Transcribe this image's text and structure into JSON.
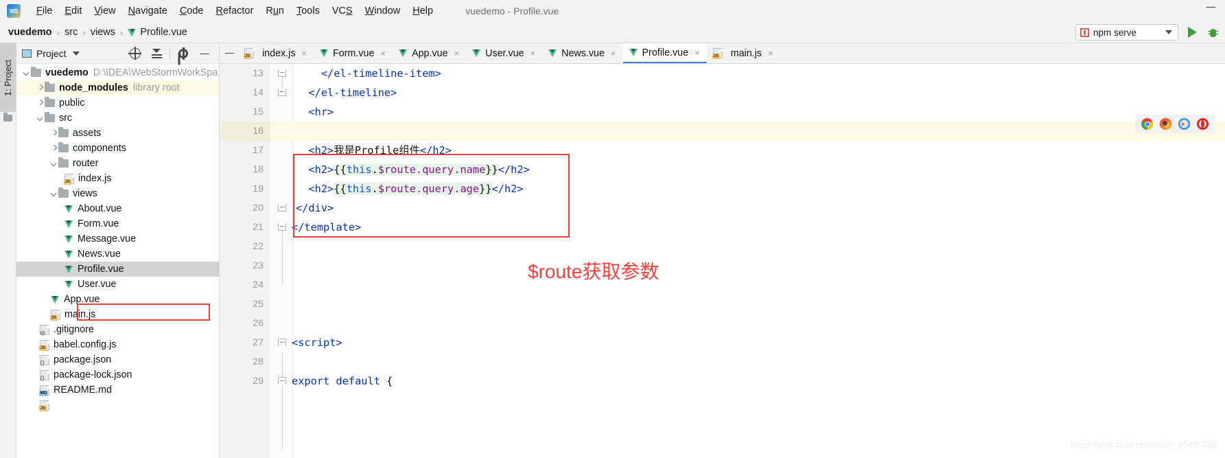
{
  "window": {
    "title": "vuedemo - Profile.vue",
    "app_icon": "webstorm-logo",
    "minimize_label": "—"
  },
  "menubar": {
    "items": [
      {
        "label": "File",
        "mnemonic": "F"
      },
      {
        "label": "Edit",
        "mnemonic": "E"
      },
      {
        "label": "View",
        "mnemonic": "V"
      },
      {
        "label": "Navigate",
        "mnemonic": "N"
      },
      {
        "label": "Code",
        "mnemonic": "C"
      },
      {
        "label": "Refactor",
        "mnemonic": "R"
      },
      {
        "label": "Run",
        "mnemonic": "u"
      },
      {
        "label": "Tools",
        "mnemonic": "T"
      },
      {
        "label": "VCS",
        "mnemonic": "S"
      },
      {
        "label": "Window",
        "mnemonic": "W"
      },
      {
        "label": "Help",
        "mnemonic": "H"
      }
    ]
  },
  "breadcrumb": {
    "separator": "›",
    "items": [
      {
        "label": "vuedemo",
        "bold": true,
        "icon": ""
      },
      {
        "label": "src",
        "bold": false,
        "icon": ""
      },
      {
        "label": "views",
        "bold": false,
        "icon": ""
      },
      {
        "label": "Profile.vue",
        "bold": false,
        "icon": "vue-icon"
      }
    ]
  },
  "run_widget": {
    "config_name": "npm serve",
    "config_icon": "npm-icon",
    "dropdown_icon": "chevron-down-icon",
    "run_icon": "run-play-icon",
    "debug_icon": "debug-bug-icon"
  },
  "toolwindow_strip": {
    "project_button": "1: Project",
    "structure_icon": "folder-icon"
  },
  "project_panel": {
    "title": "Project",
    "title_icon": "project-window-icon",
    "dropdown_icon": "chevron-down-icon",
    "toolbar_icons": [
      "locate-target-icon",
      "collapse-all-icon",
      "gear-icon",
      "hide-minus-icon"
    ],
    "tree": [
      {
        "label": "vuedemo",
        "sub": "D:\\IDEA\\WebStormWorkSpa",
        "icon": "folder-icon",
        "arrow": "down",
        "indent": 1,
        "bold": true,
        "highlight": "none"
      },
      {
        "label": "node_modules",
        "sub": "library root",
        "icon": "folder-icon",
        "arrow": "right",
        "indent": 2,
        "bold": true,
        "highlight": "yellow"
      },
      {
        "label": "public",
        "sub": "",
        "icon": "folder-icon",
        "arrow": "right",
        "indent": 2,
        "bold": false,
        "highlight": "none"
      },
      {
        "label": "src",
        "sub": "",
        "icon": "folder-icon",
        "arrow": "down",
        "indent": 2,
        "bold": false,
        "highlight": "none"
      },
      {
        "label": "assets",
        "sub": "",
        "icon": "folder-icon",
        "arrow": "right",
        "indent": 3,
        "bold": false,
        "highlight": "none"
      },
      {
        "label": "components",
        "sub": "",
        "icon": "folder-icon",
        "arrow": "right",
        "indent": 3,
        "bold": false,
        "highlight": "none"
      },
      {
        "label": "router",
        "sub": "",
        "icon": "folder-icon",
        "arrow": "down",
        "indent": 3,
        "bold": false,
        "highlight": "none"
      },
      {
        "label": "index.js",
        "sub": "",
        "icon": "js-file-icon",
        "arrow": "none",
        "indent": 4,
        "bold": false,
        "highlight": "none"
      },
      {
        "label": "views",
        "sub": "",
        "icon": "folder-icon",
        "arrow": "down",
        "indent": 3,
        "bold": false,
        "highlight": "none"
      },
      {
        "label": "About.vue",
        "sub": "",
        "icon": "vue-file-icon",
        "arrow": "none",
        "indent": 4,
        "bold": false,
        "highlight": "none"
      },
      {
        "label": "Form.vue",
        "sub": "",
        "icon": "vue-file-icon",
        "arrow": "none",
        "indent": 4,
        "bold": false,
        "highlight": "none"
      },
      {
        "label": "Message.vue",
        "sub": "",
        "icon": "vue-file-icon",
        "arrow": "none",
        "indent": 4,
        "bold": false,
        "highlight": "none"
      },
      {
        "label": "News.vue",
        "sub": "",
        "icon": "vue-file-icon",
        "arrow": "none",
        "indent": 4,
        "bold": false,
        "highlight": "none"
      },
      {
        "label": "Profile.vue",
        "sub": "",
        "icon": "vue-file-icon",
        "arrow": "none",
        "indent": 4,
        "bold": false,
        "highlight": "selected"
      },
      {
        "label": "User.vue",
        "sub": "",
        "icon": "vue-file-icon",
        "arrow": "none",
        "indent": 4,
        "bold": false,
        "highlight": "none"
      },
      {
        "label": "App.vue",
        "sub": "",
        "icon": "vue-file-icon",
        "arrow": "none",
        "indent": 3,
        "bold": false,
        "highlight": "none"
      },
      {
        "label": "main.js",
        "sub": "",
        "icon": "js-file-icon",
        "arrow": "none",
        "indent": 3,
        "bold": false,
        "highlight": "none"
      },
      {
        "label": ".gitignore",
        "sub": "",
        "icon": "gitignore-file-icon",
        "arrow": "none",
        "indent": 5,
        "bold": false,
        "highlight": "none"
      },
      {
        "label": "babel.config.js",
        "sub": "",
        "icon": "js-file-icon",
        "arrow": "none",
        "indent": 5,
        "bold": false,
        "highlight": "none"
      },
      {
        "label": "package.json",
        "sub": "",
        "icon": "json-file-icon",
        "arrow": "none",
        "indent": 5,
        "bold": false,
        "highlight": "none"
      },
      {
        "label": "package-lock.json",
        "sub": "",
        "icon": "json-file-icon",
        "arrow": "none",
        "indent": 5,
        "bold": false,
        "highlight": "none"
      },
      {
        "label": "README.md",
        "sub": "",
        "icon": "md-file-icon",
        "arrow": "none",
        "indent": 5,
        "bold": false,
        "highlight": "none"
      }
    ]
  },
  "editor": {
    "tabs": [
      {
        "label": "index.js",
        "icon": "js-file-icon",
        "active": false,
        "closable": true
      },
      {
        "label": "Form.vue",
        "icon": "vue-file-icon",
        "active": false,
        "closable": true
      },
      {
        "label": "App.vue",
        "icon": "vue-file-icon",
        "active": false,
        "closable": true
      },
      {
        "label": "User.vue",
        "icon": "vue-file-icon",
        "active": false,
        "closable": true
      },
      {
        "label": "News.vue",
        "icon": "vue-file-icon",
        "active": false,
        "closable": true
      },
      {
        "label": "Profile.vue",
        "icon": "vue-file-icon",
        "active": true,
        "closable": true
      },
      {
        "label": "main.js",
        "icon": "js-file-icon",
        "active": false,
        "closable": true
      }
    ],
    "close_glyph": "×",
    "hide_glyph": "—",
    "lines": [
      {
        "num": "13",
        "text": "    </el-timeline-item>"
      },
      {
        "num": "14",
        "text": "  </el-timeline>"
      },
      {
        "num": "15",
        "text": "  <hr>"
      },
      {
        "num": "16",
        "text": ""
      },
      {
        "num": "17",
        "text": "  <h2>我是Profile组件</h2>"
      },
      {
        "num": "18",
        "text": "  <h2>{{this.$route.query.name}}</h2>"
      },
      {
        "num": "19",
        "text": "  <h2>{{this.$route.query.age}}</h2>"
      },
      {
        "num": "20",
        "text": "  </div>"
      },
      {
        "num": "21",
        "text": "</template>"
      },
      {
        "num": "22",
        "text": ""
      },
      {
        "num": "23",
        "text": ""
      },
      {
        "num": "24",
        "text": ""
      },
      {
        "num": "25",
        "text": ""
      },
      {
        "num": "26",
        "text": ""
      },
      {
        "num": "27",
        "text": "<script>"
      },
      {
        "num": "28",
        "text": ""
      },
      {
        "num": "29",
        "text": "export default {"
      }
    ],
    "code_tokens": {
      "l13_a": "  ",
      "l13_b": "</el-timeline-item>",
      "l14_a": "",
      "l14_b": "</el-timeline>",
      "l15_b": "<hr>",
      "l17_tag1": "<h2>",
      "l17_txt": "我是Profile组件",
      "l17_tag2": "</h2>",
      "l18_tag1": "<h2>",
      "l18_br1": "{{",
      "l18_this": "this",
      "l18_dot": ".",
      "l18_prop": "$route.query.name",
      "l18_br2": "}}",
      "l18_tag2": "</h2>",
      "l19_tag1": "<h2>",
      "l19_br1": "{{",
      "l19_this": "this",
      "l19_dot": ".",
      "l19_prop": "$route.query.age",
      "l19_br2": "}}",
      "l19_tag2": "</h2>",
      "l20_b": "</div>",
      "l21_b": "</template>",
      "l27_b": "<script>",
      "l29_kw": "export default",
      "l29_rest": " {"
    },
    "annotation": "$route获取参数",
    "annotation_color": "#f3403a",
    "highlight_box_color": "#ef3b36"
  },
  "browser_popup": {
    "browsers": [
      {
        "name": "chrome-icon"
      },
      {
        "name": "firefox-icon"
      },
      {
        "name": "safari-icon"
      },
      {
        "name": "opera-icon"
      }
    ]
  },
  "watermark": "https://blog.csdn.net/weixin_45480785"
}
